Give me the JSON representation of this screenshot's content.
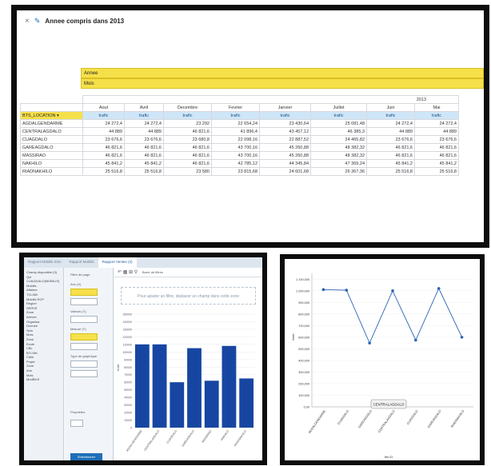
{
  "header": {
    "close_icon": "×",
    "edit_icon": "pencil-icon",
    "title": "Annee compris dans 2013"
  },
  "pivot": {
    "row_label_1": "Annee",
    "row_label_2": "Mois",
    "year": "2013",
    "location_header": "BTS_LOCATION",
    "months": [
      "Aout",
      "Avril",
      "Decembre",
      "Fevrier",
      "Janvier",
      "Juillet",
      "Juin",
      "Mai"
    ],
    "measure": "trafic",
    "rows": [
      {
        "loc": "AGDALGENDARME",
        "vals": [
          "24 272,4",
          "24 272,4",
          "23 292",
          "22 654,24",
          "23 430,64",
          "25 081,48",
          "24 272,4",
          "24 272,4"
        ]
      },
      {
        "loc": "CENTRALAGDALO",
        "vals": [
          "44 889",
          "44 889",
          "46 821,6",
          "41 896,4",
          "43 457,12",
          "46 385,3",
          "44 889",
          "44 889"
        ]
      },
      {
        "loc": "CUAGDALO",
        "vals": [
          "23 676,6",
          "23 676,6",
          "23 680,8",
          "22 098,16",
          "22 887,52",
          "24 465,82",
          "23 676,6",
          "23 676,6"
        ]
      },
      {
        "loc": "GAREAGDALO",
        "vals": [
          "46 821,6",
          "46 821,6",
          "46 821,6",
          "43 700,16",
          "45 260,88",
          "48 382,32",
          "46 821,6",
          "46 821,6"
        ]
      },
      {
        "loc": "MASSIRAO",
        "vals": [
          "46 821,6",
          "46 821,6",
          "46 821,6",
          "43 700,16",
          "45 260,88",
          "48 382,32",
          "46 821,6",
          "46 821,6"
        ]
      },
      {
        "loc": "NAKHILO",
        "vals": [
          "45 841,2",
          "45 841,2",
          "46 821,6",
          "42 785,12",
          "44 345,84",
          "47 369,24",
          "45 841,2",
          "45 841,2"
        ]
      },
      {
        "loc": "RIADNAKHILO",
        "vals": [
          "25 516,8",
          "25 516,8",
          "23 580",
          "23 815,68",
          "24 601,68",
          "26 367,36",
          "25 516,8",
          "25 516,8"
        ]
      }
    ]
  },
  "designer": {
    "tabs": [
      "Rapport Mobilis Sms",
      "Rapport Mobilis",
      "Rapport Ventes (2)"
    ],
    "fields": [
      "Champ disponible (3)",
      "Qui",
      "CUAGDALO(MOBILIS)",
      "Mobilis",
      "Affaires",
      "TCLINK",
      "Mobilis RCP",
      "Region",
      "SERVE",
      "Zone",
      "Arrivee",
      "Organisa",
      "Donnee",
      "Sem",
      "Mois",
      "Zone",
      "Ecole",
      "CBL",
      "BTLINK",
      "Cible",
      "Projet",
      "Zone",
      "Ann",
      "Mois",
      "ModBILE"
    ],
    "options": [
      "Filtre de page",
      "Axe (X)",
      "Valeurs (Y)",
      "Mesure (Y)",
      "Type de graphique",
      "Proprietes",
      "Selectionner"
    ],
    "option_button": "Selectionner",
    "toolbar": "Barre de filtres",
    "drop_hint": "Pour ajouter un filtre, deplacer un champ dans cette zone"
  },
  "colors": {
    "bar": "#1746a2",
    "line": "#2b63b4",
    "header_yellow": "#f6e04a",
    "measure_blue": "#cfe6f8"
  },
  "chart_data": [
    {
      "type": "bar",
      "categories": [
        "AGDALGENDARME",
        "CENTRALAGDALO",
        "CUAGDALO",
        "GAREAGDALO",
        "MASSIRAO",
        "NAKHILO",
        "RIADNAKHILO"
      ],
      "values": [
        110000,
        110000,
        60000,
        105000,
        62000,
        108000,
        65000
      ],
      "ylim": [
        0,
        150000
      ],
      "xlabel": "Bts ID",
      "ylabel": "trafic"
    },
    {
      "type": "line",
      "categories": [
        "AGDALGENDARME",
        "CUAGDALO",
        "GAREAGDALO",
        "CENTRALAGDALO",
        "CUAGDALO",
        "GAREAGDALO",
        "RIADNAKHILO"
      ],
      "values": [
        1010000,
        1005000,
        550000,
        1000000,
        575000,
        1020000,
        600000
      ],
      "ylim": [
        0,
        1150000
      ],
      "yticks": [
        "0,00",
        "100,000",
        "200,000",
        "300,000",
        "400,000",
        "500,000",
        "600,000",
        "700,000",
        "800,000",
        "900,000",
        "1 000,000",
        "1 100,000"
      ],
      "tooltip": "CENTRALAGDALO",
      "xlabel": "bts ID",
      "ylabel": "trafic"
    }
  ]
}
